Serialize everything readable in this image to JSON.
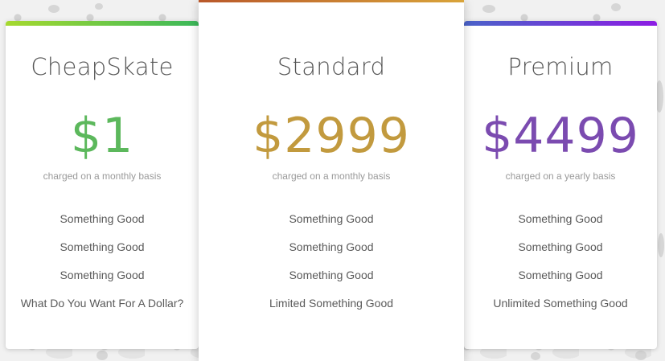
{
  "plans": [
    {
      "name": "CheapSkate",
      "price": "$1",
      "basis": "charged on a monthly basis",
      "accent": "#5cb85c",
      "bar_gradient": [
        "#a6d92f",
        "#3bb85a"
      ],
      "features": [
        "Something Good",
        "Something Good",
        "Something Good",
        "What Do You Want For A Dollar?"
      ]
    },
    {
      "name": "Standard",
      "price": "$2999",
      "basis": "charged on a monthly basis",
      "accent": "#c29a3e",
      "bar_gradient": [
        "#b9582a",
        "#d9a43a"
      ],
      "features": [
        "Something Good",
        "Something Good",
        "Something Good",
        "Limited Something Good"
      ]
    },
    {
      "name": "Premium",
      "price": "$4499",
      "basis": "charged on a yearly basis",
      "accent": "#7b4bb0",
      "bar_gradient": [
        "#4a63c9",
        "#8c1ce3"
      ],
      "features": [
        "Something Good",
        "Something Good",
        "Something Good",
        "Unlimited Something Good"
      ]
    }
  ]
}
